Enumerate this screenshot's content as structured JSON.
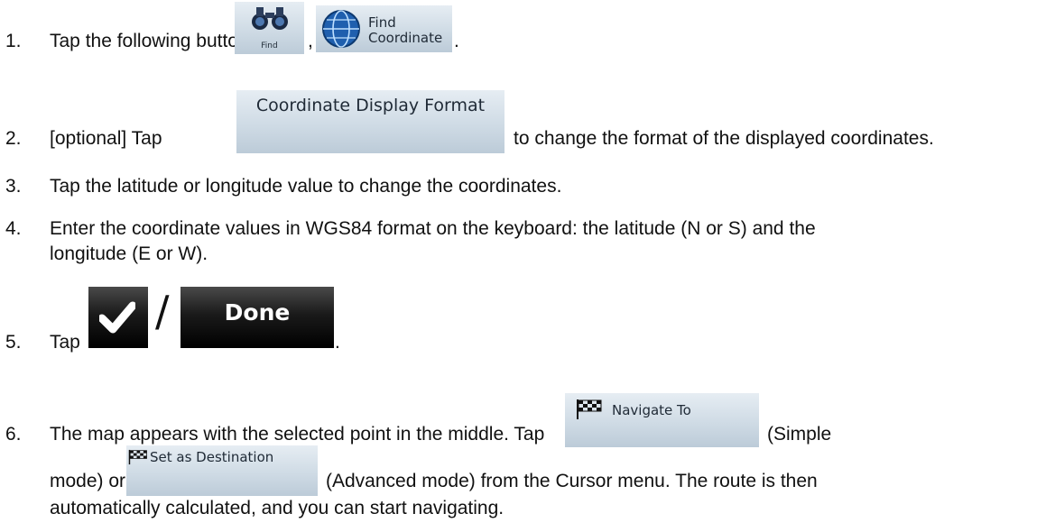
{
  "steps": [
    {
      "number": "1.",
      "text_before": "Tap the following buttons:",
      "sep": ",",
      "end": "."
    },
    {
      "number": "2.",
      "text_before": "[optional] Tap",
      "text_after": "to change the format of the displayed coordinates."
    },
    {
      "number": "3.",
      "text": "Tap the latitude or longitude value to change the coordinates."
    },
    {
      "number": "4.",
      "line1": "Enter the coordinate values in WGS84 format on the keyboard: the latitude (N or S) and the",
      "line2": "longitude (E or W)."
    },
    {
      "number": "5.",
      "text_before": "Tap",
      "slash": "/",
      "end": "."
    },
    {
      "number": "6.",
      "line1": "The map appears with the selected point in the middle. Tap",
      "line1_after": "(Simple",
      "line2_before": "mode) or",
      "line2_after": "(Advanced mode) from the Cursor menu. The route is then",
      "line3": "automatically calculated, and you can start navigating."
    }
  ],
  "buttons": {
    "find": "Find",
    "find_coordinate_line1": "Find",
    "find_coordinate_line2": "Coordinate",
    "coordinate_display_format": "Coordinate Display Format",
    "done": "Done",
    "navigate_to": "Navigate To",
    "set_as_destination": "Set as Destination"
  }
}
